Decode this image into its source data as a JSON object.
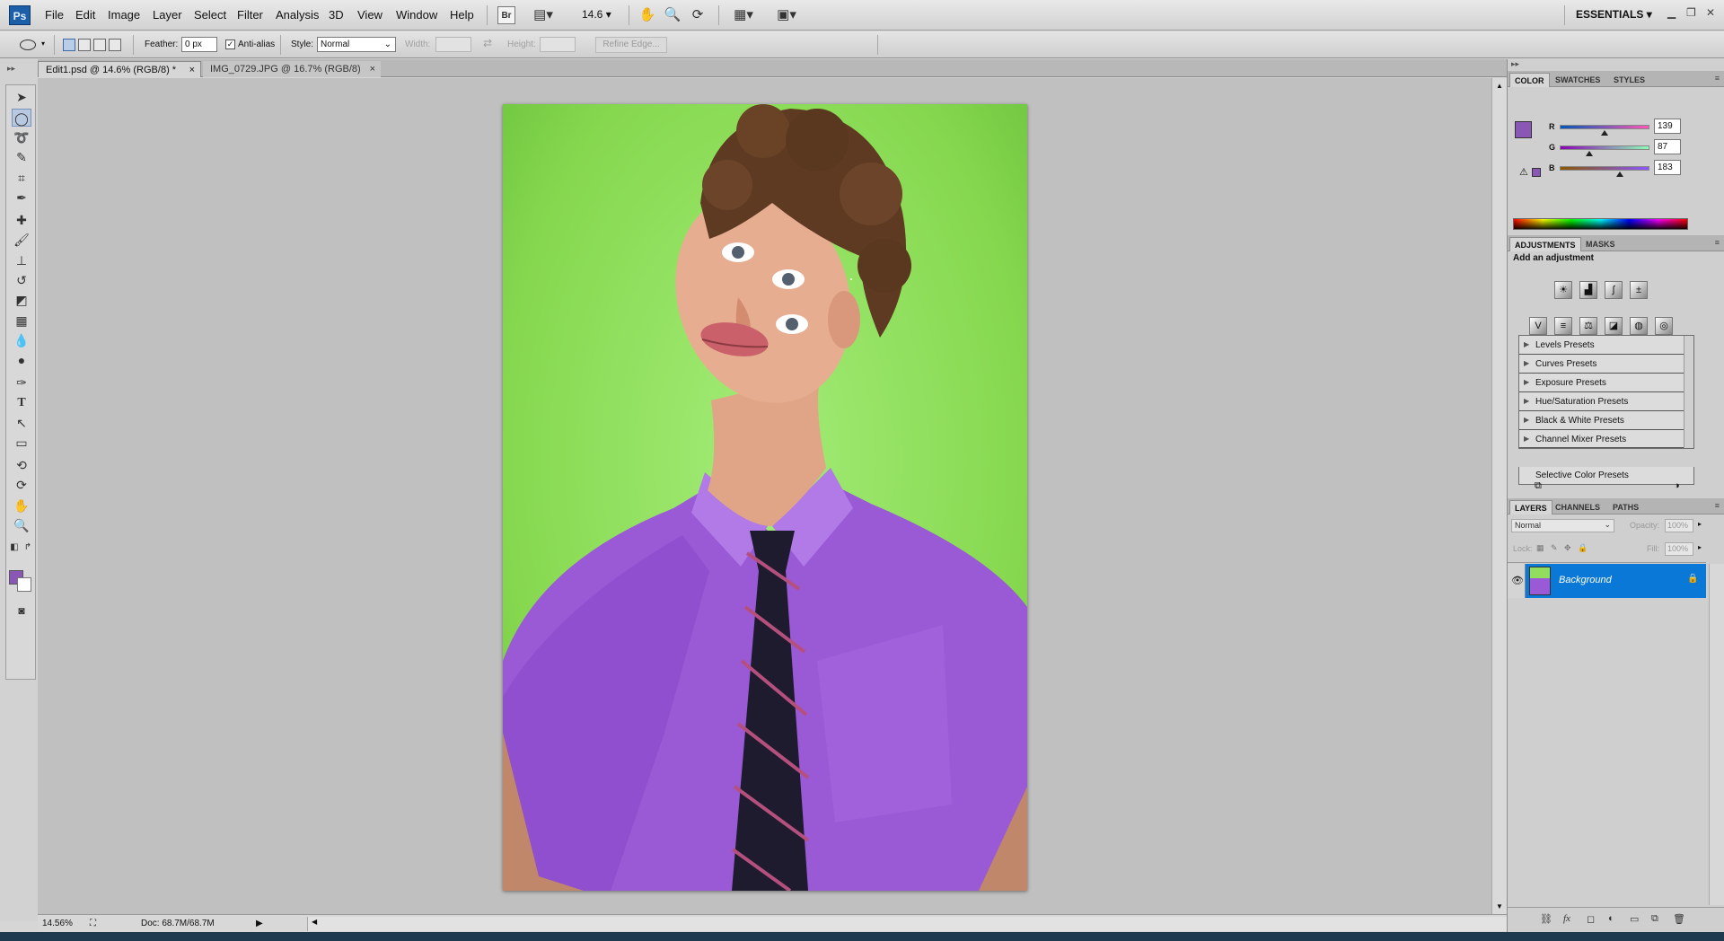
{
  "app": {
    "logo": "Ps"
  },
  "menu": [
    "File",
    "Edit",
    "Image",
    "Layer",
    "Select",
    "Filter",
    "Analysis",
    "3D",
    "View",
    "Window",
    "Help"
  ],
  "menubar": {
    "zoom": "14.6",
    "workspace": "ESSENTIALS",
    "icons": [
      "bridge-icon",
      "mini-bridge-icon",
      "hand-icon",
      "zoom-icon",
      "rotate-view-icon",
      "arrange-documents-icon",
      "screen-mode-icon"
    ]
  },
  "options": {
    "feather_label": "Feather:",
    "feather_value": "0 px",
    "antialias_label": "Anti-alias",
    "antialias_checked": true,
    "style_label": "Style:",
    "style_value": "Normal",
    "width_label": "Width:",
    "height_label": "Height:",
    "refine_edge": "Refine Edge..."
  },
  "tabs": [
    {
      "label": "Edit1.psd @ 14.6% (RGB/8) *",
      "active": true
    },
    {
      "label": "IMG_0729.JPG @ 16.7% (RGB/8)",
      "active": false
    }
  ],
  "status": {
    "zoom": "14.56%",
    "doc": "Doc: 68.7M/68.7M"
  },
  "color_panel": {
    "tabs": [
      "COLOR",
      "SWATCHES",
      "STYLES"
    ],
    "foreground": "#8b57b7",
    "background": "#ffffff",
    "channels": [
      {
        "label": "R",
        "value": "139"
      },
      {
        "label": "G",
        "value": "87"
      },
      {
        "label": "B",
        "value": "183"
      }
    ]
  },
  "adjustments_panel": {
    "tabs": [
      "ADJUSTMENTS",
      "MASKS"
    ],
    "heading": "Add an adjustment",
    "presets": [
      "Levels Presets",
      "Curves Presets",
      "Exposure Presets",
      "Hue/Saturation Presets",
      "Black & White Presets",
      "Channel Mixer Presets",
      "Selective Color Presets"
    ]
  },
  "layers_panel": {
    "tabs": [
      "LAYERS",
      "CHANNELS",
      "PATHS"
    ],
    "blend_mode": "Normal",
    "opacity_label": "Opacity:",
    "opacity_value": "100%",
    "lock_label": "Lock:",
    "fill_label": "Fill:",
    "fill_value": "100%",
    "layers": [
      {
        "name": "Background",
        "locked": true,
        "visible": true,
        "selected": true
      }
    ]
  },
  "colors": {
    "accent": "#0a78d7",
    "canvas_bg": "#c0c0c0",
    "image_green": "#8fdd5a",
    "shirt_purple": "#9a5ad6"
  }
}
